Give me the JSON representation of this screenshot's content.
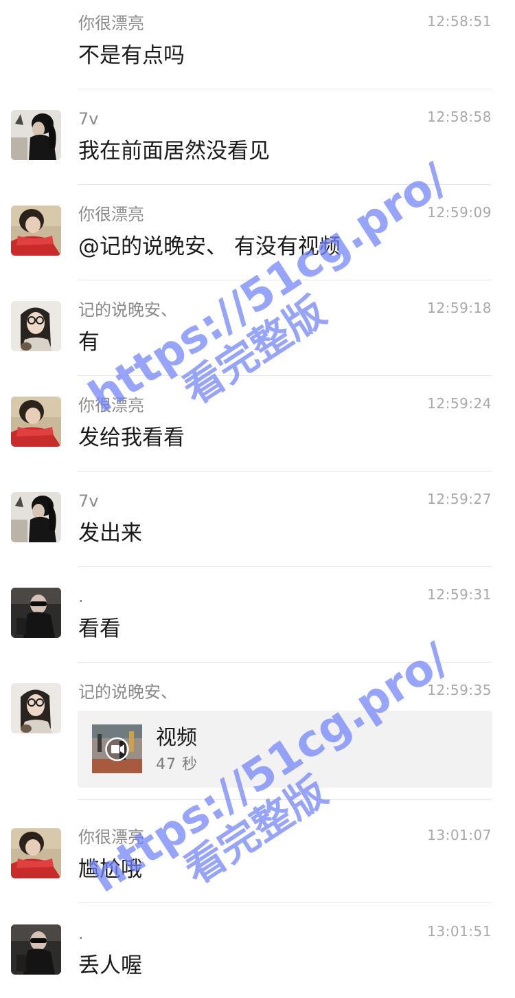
{
  "messages": [
    {
      "sender": "你很漂亮",
      "time": "12:58:51",
      "text": "不是有点吗",
      "avatar": "red-sweater-girl"
    },
    {
      "sender": "7v",
      "time": "12:58:58",
      "text": "我在前面居然没看见",
      "avatar": "black-hair-girl"
    },
    {
      "sender": "你很漂亮",
      "time": "12:59:09",
      "text": "@记的说晚安、 有没有视频",
      "avatar": "red-sweater-girl"
    },
    {
      "sender": "记的说晚安、",
      "time": "12:59:18",
      "text": "有",
      "avatar": "glasses-girl"
    },
    {
      "sender": "你很漂亮",
      "time": "12:59:24",
      "text": "发给我看看",
      "avatar": "red-sweater-girl"
    },
    {
      "sender": "7v",
      "time": "12:59:27",
      "text": "发出来",
      "avatar": "black-hair-girl"
    },
    {
      "sender": ".",
      "time": "12:59:31",
      "text": "看看",
      "avatar": "dark-sunglasses"
    },
    {
      "sender": "记的说晚安、",
      "time": "12:59:35",
      "avatar": "glasses-girl",
      "video": {
        "title": "视频",
        "duration": "47 秒"
      }
    },
    {
      "sender": "你很漂亮",
      "time": "13:01:07",
      "text": "尴尬哦",
      "avatar": "red-sweater-girl"
    },
    {
      "sender": ".",
      "time": "13:01:51",
      "text": "丢人喔",
      "avatar": "dark-sunglasses"
    }
  ],
  "watermark": {
    "url": "https://51cg.pro/",
    "caption": "看完整版"
  }
}
